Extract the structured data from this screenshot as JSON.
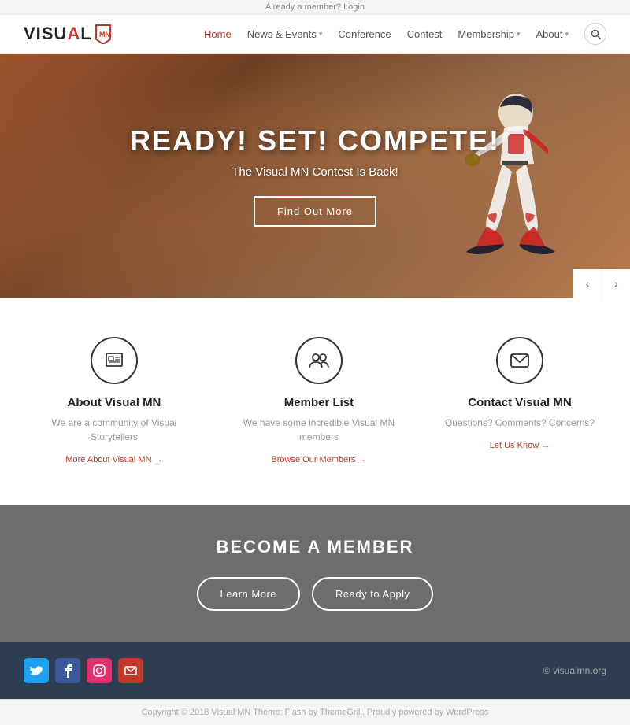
{
  "topbar": {
    "text": "Already a member?",
    "login_link": "Login"
  },
  "header": {
    "logo_text": "VISU",
    "logo_highlight": "AL",
    "logo_mn": "✦",
    "nav": [
      {
        "label": "Home",
        "active": true,
        "has_dropdown": false
      },
      {
        "label": "News & Events",
        "active": false,
        "has_dropdown": true
      },
      {
        "label": "Conference",
        "active": false,
        "has_dropdown": false
      },
      {
        "label": "Contest",
        "active": false,
        "has_dropdown": false
      },
      {
        "label": "Membership",
        "active": false,
        "has_dropdown": true
      },
      {
        "label": "About",
        "active": false,
        "has_dropdown": true
      }
    ],
    "search_icon": "🔍"
  },
  "hero": {
    "title": "READY! SET! COMPETE!",
    "subtitle": "The Visual MN Contest Is Back!",
    "button_label": "Find Out More"
  },
  "info_items": [
    {
      "icon": "🖼",
      "title": "About Visual MN",
      "description": "We are a community of Visual Storytellers",
      "link": "More About Visual MN"
    },
    {
      "icon": "👥",
      "title": "Member List",
      "description": "We have some incredible Visual MN members",
      "link": "Browse Our Members"
    },
    {
      "icon": "✉",
      "title": "Contact Visual MN",
      "description": "Questions? Comments? Concerns?",
      "link": "Let Us Know"
    }
  ],
  "become_member": {
    "title": "BECOME A MEMBER",
    "btn_learn": "Learn More",
    "btn_apply": "Ready to Apply"
  },
  "footer": {
    "social": [
      {
        "icon": "t",
        "label": "twitter",
        "class": "social-twitter"
      },
      {
        "icon": "f",
        "label": "facebook",
        "class": "social-facebook"
      },
      {
        "icon": "◉",
        "label": "instagram",
        "class": "social-instagram"
      },
      {
        "icon": "✉",
        "label": "email",
        "class": "social-email"
      }
    ],
    "copyright": "© visualmn.org"
  },
  "bottombar": {
    "text": "Copyright © 2018 Visual MN Theme: Flash by ThemeGrill. Proudly powered by WordPress"
  }
}
